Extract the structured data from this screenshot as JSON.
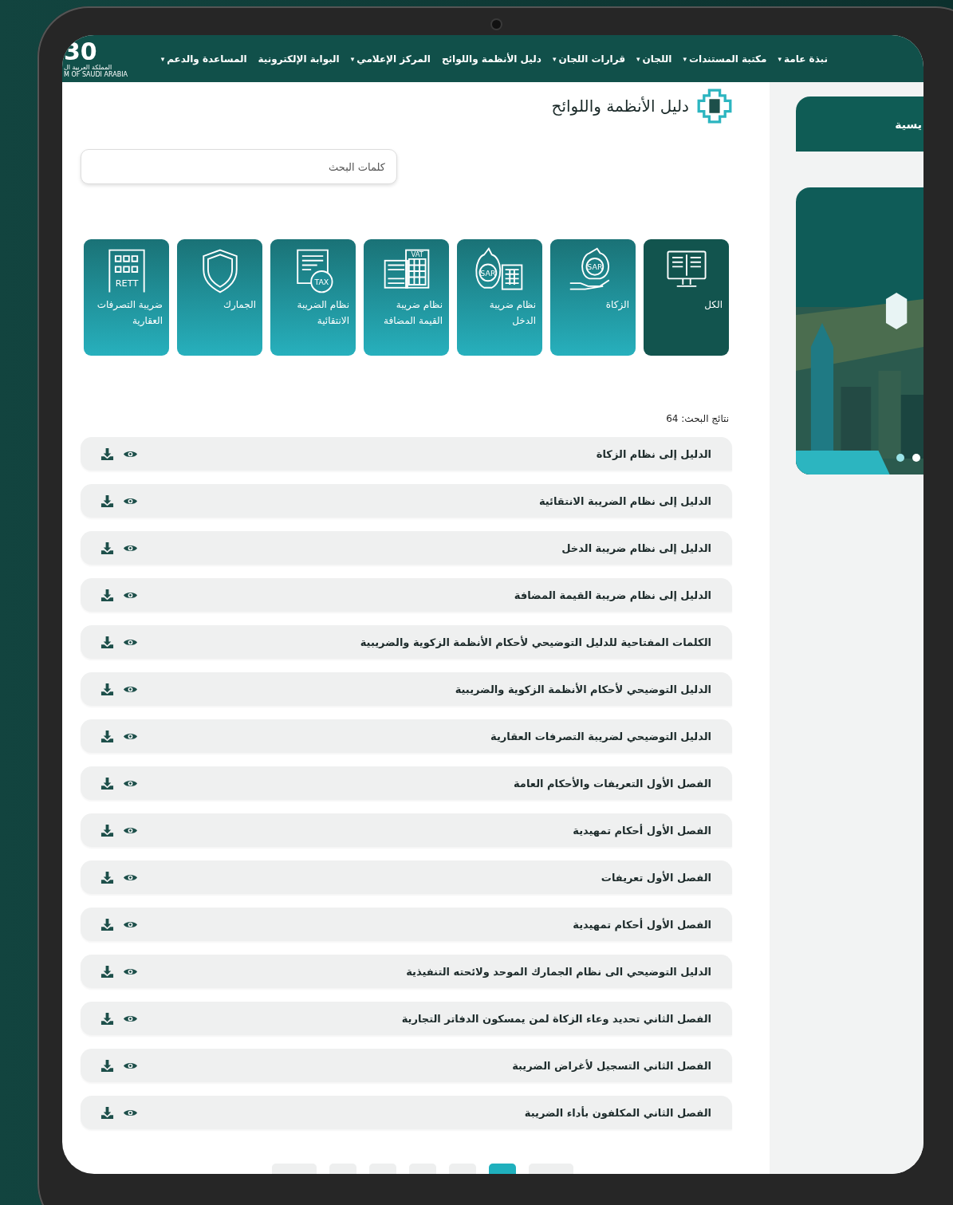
{
  "logo": {
    "numeral": "30",
    "arabic": "المملكة العربية ال",
    "english": "M OF SAUDI ARABIA"
  },
  "nav": [
    {
      "label": "نبذة عامة",
      "caret": "▾"
    },
    {
      "label": "مكتبة المستندات",
      "caret": "▾"
    },
    {
      "label": "اللجان",
      "caret": "▾"
    },
    {
      "label": "قرارات اللجان",
      "caret": "▾"
    },
    {
      "label": "دليل الأنظمة واللوائح"
    },
    {
      "label": "المركز الإعلامي",
      "caret": "▾"
    },
    {
      "label": "البوابة الإلكترونية"
    },
    {
      "label": "المساعدة والدعم",
      "caret": "▾"
    }
  ],
  "page_title": "دليل الأنظمة واللوائح",
  "search": {
    "placeholder": "كلمات البحث"
  },
  "categories": [
    {
      "label": "الكل",
      "kind": "book",
      "selected": true
    },
    {
      "label": "الزكاة",
      "kind": "moneybag",
      "icon_text": "SAR",
      "selected": false
    },
    {
      "label": "نظام ضريبة الدخل",
      "kind": "calculator",
      "icon_text": "SAR",
      "selected": false
    },
    {
      "label": "نظام ضريبة القيمة المضافة",
      "kind": "cash",
      "icon_text": "VAT",
      "selected": false
    },
    {
      "label": "نظام الضريبة الانتقائية",
      "kind": "document",
      "icon_text": "TAX",
      "selected": false
    },
    {
      "label": "الجمارك",
      "kind": "shield",
      "selected": false
    },
    {
      "label": "ضريبة التصرفات العقارية",
      "kind": "building",
      "icon_text": "RETT",
      "selected": false
    }
  ],
  "results_label": "نتائج البحث: 64",
  "results": [
    {
      "title": "الدليل إلى نظام الزكاة"
    },
    {
      "title": "الدليل إلى نظام الضريبة الانتقائية"
    },
    {
      "title": "الدليل إلى نظام ضريبة الدخل"
    },
    {
      "title": "الدليل إلى نظام ضريبة القيمة المضافة"
    },
    {
      "title": "الكلمات المفتاحية للدليل التوضيحي لأحكام الأنظمة الزكوية والضريبية"
    },
    {
      "title": "الدليل التوضيحي لأحكام الأنظمة الزكوية والضريبية"
    },
    {
      "title": "الدليل التوضيحي لضريبة التصرفات العقارية"
    },
    {
      "title": "الفصل الأول التعريفات والأحكام العامة"
    },
    {
      "title": "الفصل الأول أحكام تمهيدية"
    },
    {
      "title": "الفصل الأول تعريفات"
    },
    {
      "title": "الفصل الأول أحكام تمهيدية"
    },
    {
      "title": "الدليل التوضيحي الى نظام الجمارك الموحد ولائحته التنفيذية"
    },
    {
      "title": "الفصل الثاني تحديد وعاء الزكاة لمن يمسكون الدفاتر التجارية"
    },
    {
      "title": "الفصل الثاني التسجيل لأغراض الضريبة"
    },
    {
      "title": "الفصل الثاني المكلفون بأداء الضريبة"
    }
  ],
  "pagination": [
    {
      "selected": false
    },
    {
      "selected": false
    },
    {
      "selected": false
    },
    {
      "selected": false
    },
    {
      "selected": false
    },
    {
      "selected": true
    },
    {
      "selected": false
    }
  ],
  "side_panel": {
    "header": "يسية",
    "slides": [
      {
        "selected": false
      },
      {
        "selected": true
      }
    ]
  }
}
